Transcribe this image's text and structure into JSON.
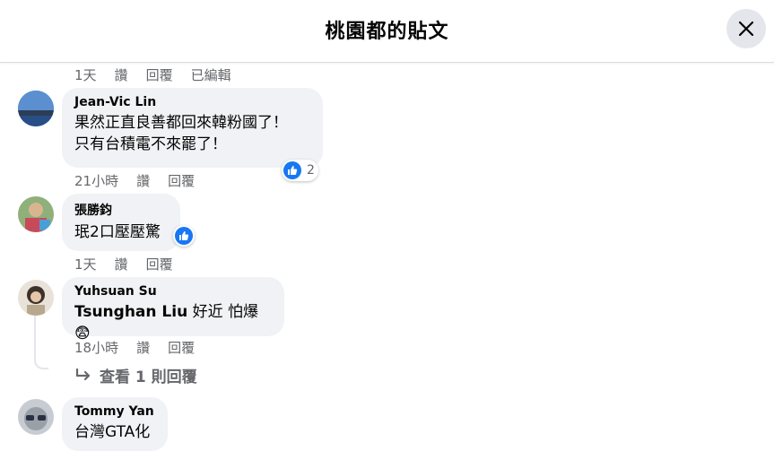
{
  "header": {
    "title": "桃園都的貼文"
  },
  "actions": {
    "like": "讚",
    "reply": "回覆",
    "edited": "已編輯"
  },
  "comments": [
    {
      "time": "1天"
    },
    {
      "author": "Jean-Vic Lin",
      "lines": [
        "果然正直良善都回來韓粉國了！",
        "只有台積電不來罷了！"
      ],
      "time": "21小時",
      "reaction_count": "2"
    },
    {
      "author": "張勝鈞",
      "lines": [
        "珉2口壓壓驚"
      ],
      "time": "1天"
    },
    {
      "author": "Yuhsuan Su",
      "mention": "Tsunghan Liu",
      "text": " 好近 怕爆",
      "emoji": "😨",
      "time": "18小時"
    },
    {
      "author": "Tommy Yan",
      "lines": [
        "台灣GTA化"
      ]
    }
  ],
  "replies": {
    "label": "查看 1 則回覆"
  }
}
